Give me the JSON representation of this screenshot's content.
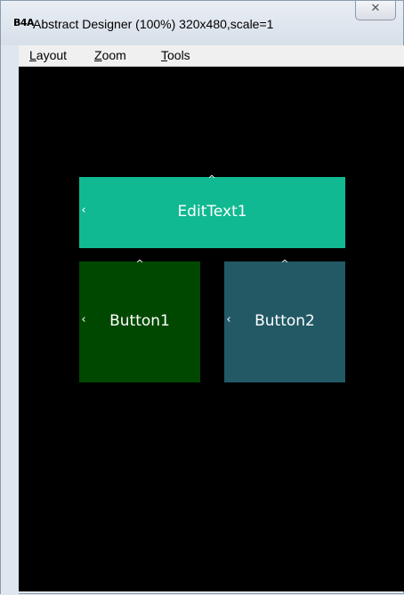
{
  "window": {
    "app_icon": "B4A",
    "title": "Abstract Designer (100%) 320x480,scale=1",
    "close_glyph": "✕"
  },
  "menu": {
    "items": [
      {
        "id": "layout",
        "accel": "L",
        "rest": "ayout"
      },
      {
        "id": "zoom",
        "accel": "Z",
        "rest": "oom"
      },
      {
        "id": "tools",
        "accel": "T",
        "rest": "ools"
      }
    ]
  },
  "canvas": {
    "background": "#000000",
    "views": {
      "edittext1": {
        "label": "EditText1",
        "color": "#10b991"
      },
      "button1": {
        "label": "Button1",
        "color": "#004800"
      },
      "button2": {
        "label": "Button2",
        "color": "#225965"
      }
    },
    "handle_up_glyph": "^",
    "handle_left_glyph": "‹"
  }
}
